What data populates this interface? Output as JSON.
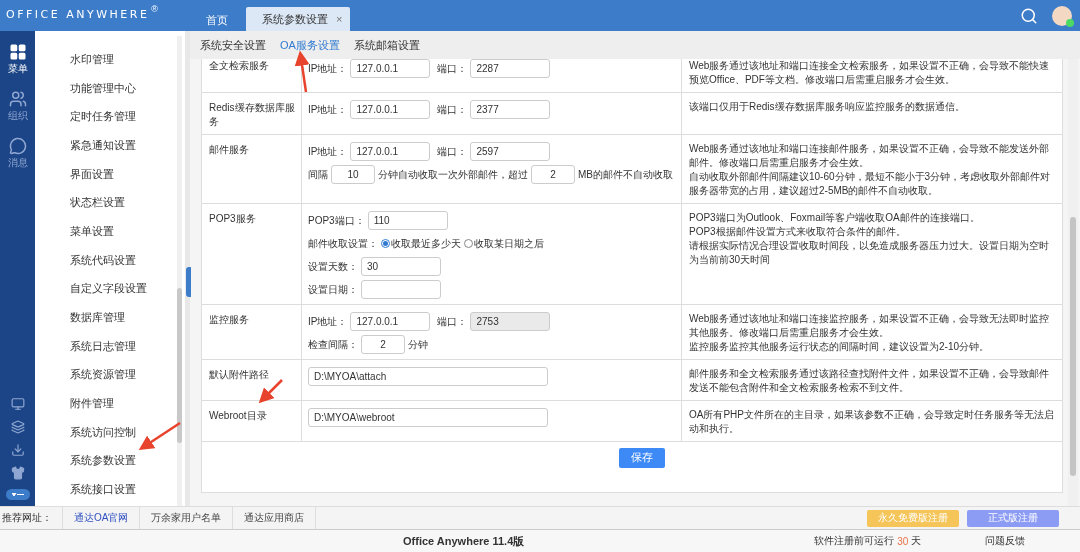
{
  "header": {
    "logo": "OFFICE ANYWHERE",
    "logo_mark": "®",
    "tabs": [
      {
        "label": "首页",
        "selected": false
      },
      {
        "label": "系统参数设置",
        "selected": true,
        "close": "×"
      }
    ]
  },
  "rail": {
    "items": [
      {
        "kind": "grid",
        "label": "菜单",
        "selected": true
      },
      {
        "kind": "users",
        "label": "组织",
        "selected": false
      },
      {
        "kind": "chat",
        "label": "消息",
        "selected": false
      }
    ],
    "tools": [
      {
        "kind": "monitor"
      },
      {
        "kind": "list"
      },
      {
        "kind": "download"
      },
      {
        "kind": "shirt"
      },
      {
        "kind": "toggle"
      }
    ]
  },
  "menu": {
    "items": [
      "水印管理",
      "功能管理中心",
      "定时任务管理",
      "紧急通知设置",
      "界面设置",
      "状态栏设置",
      "菜单设置",
      "系统代码设置",
      "自定义字段设置",
      "数据库管理",
      "系统日志管理",
      "系统资源管理",
      "附件管理",
      "系统访问控制",
      "系统参数设置",
      "系统接口设置"
    ]
  },
  "subtabs": [
    {
      "label": "系统安全设置",
      "selected": false
    },
    {
      "label": "OA服务设置",
      "selected": true
    },
    {
      "label": "系统邮箱设置",
      "selected": false
    }
  ],
  "rows": [
    {
      "label": "全文检索服务",
      "lines": [
        [
          {
            "kind": "label",
            "text": "IP地址："
          },
          {
            "kind": "field",
            "value": "127.0.0.1",
            "disabled": false
          },
          {
            "kind": "label",
            "text": "端口："
          },
          {
            "kind": "field",
            "value": "2287",
            "disabled": false
          }
        ]
      ],
      "notes": [
        "Web服务通过该地址和端口连接全文检索服务，如果设置不正确，会导致不能快速预览Office、PDF等文档。修改端口后需重启服务才会生效。"
      ]
    },
    {
      "label": "Redis缓存数据库服务",
      "lines": [
        [
          {
            "kind": "label",
            "text": "IP地址："
          },
          {
            "kind": "field",
            "value": "127.0.0.1",
            "disabled": false
          },
          {
            "kind": "label",
            "text": "端口："
          },
          {
            "kind": "field",
            "value": "2377",
            "disabled": false
          }
        ]
      ],
      "notes": [
        "该端口仅用于Redis缓存数据库服务响应监控服务的数据通信。"
      ]
    },
    {
      "label": "邮件服务",
      "lines": [
        [
          {
            "kind": "label",
            "text": "IP地址："
          },
          {
            "kind": "field",
            "value": "127.0.0.1",
            "disabled": false
          },
          {
            "kind": "label",
            "text": "端口："
          },
          {
            "kind": "field",
            "value": "2597",
            "disabled": false
          }
        ],
        [
          {
            "kind": "label",
            "text": "间隔"
          },
          {
            "kind": "number",
            "value": "10",
            "disabled": false
          },
          {
            "kind": "label",
            "text": "分钟自动收取一次外部邮件，超过"
          },
          {
            "kind": "number",
            "value": "2",
            "disabled": false
          },
          {
            "kind": "label",
            "text": "MB的邮件不自动收取"
          }
        ]
      ],
      "notes": [
        "Web服务通过该地址和端口连接邮件服务，如果设置不正确，会导致不能发送外部邮件。修改端口后需重启服务才会生效。",
        "自动收取外部邮件间隔建议10-60分钟，最短不能小于3分钟，考虑收取外部邮件对服务器带宽的占用，建议超过2-5MB的邮件不自动收取。"
      ]
    },
    {
      "label": "POP3服务",
      "lines": [
        [
          {
            "kind": "label",
            "text": "POP3端口："
          },
          {
            "kind": "field",
            "value": "110",
            "disabled": false
          }
        ],
        [
          {
            "kind": "label",
            "text": "邮件收取设置："
          },
          {
            "kind": "radio",
            "text": "收取最近多少天",
            "selected": true
          },
          {
            "kind": "radio",
            "text": "收取某日期之后",
            "selected": false
          }
        ],
        [
          {
            "kind": "label",
            "text": "设置天数："
          },
          {
            "kind": "field",
            "value": "30",
            "disabled": false
          }
        ],
        [
          {
            "kind": "label",
            "text": "设置日期："
          },
          {
            "kind": "field",
            "disabled": false
          }
        ]
      ],
      "notes": [
        "POP3端口为Outlook、Foxmail等客户端收取OA邮件的连接端口。",
        "POP3根据邮件设置方式来收取符合条件的邮件。",
        "请根据实际情况合理设置收取时间段，以免造成服务器压力过大。设置日期为空时为当前前30天时间"
      ]
    },
    {
      "label": "监控服务",
      "lines": [
        [
          {
            "kind": "label",
            "text": "IP地址："
          },
          {
            "kind": "field",
            "value": "127.0.0.1",
            "disabled": false
          },
          {
            "kind": "label",
            "text": "端口："
          },
          {
            "kind": "field",
            "value": "2753",
            "disabled": true
          }
        ],
        [
          {
            "kind": "label",
            "text": "检查间隔："
          },
          {
            "kind": "number",
            "value": "2",
            "disabled": false
          },
          {
            "kind": "label",
            "text": "分钟"
          }
        ]
      ],
      "notes": [
        "Web服务通过该地址和端口连接监控服务，如果设置不正确，会导致无法即时监控其他服务。修改端口后需重启服务才会生效。",
        "监控服务监控其他服务运行状态的间隔时间，建议设置为2-10分钟。"
      ]
    },
    {
      "label": "默认附件路径",
      "lines": [
        [
          {
            "kind": "path",
            "value": "D:\\MYOA\\attach",
            "disabled": false
          }
        ]
      ],
      "notes": [
        "邮件服务和全文检索服务通过该路径查找附件文件，如果设置不正确，会导致邮件发送不能包含附件和全文检索服务检索不到文件。"
      ]
    },
    {
      "label": "Webroot目录",
      "lines": [
        [
          {
            "kind": "path",
            "value": "D:\\MYOA\\webroot",
            "disabled": false
          }
        ]
      ],
      "notes": [
        "OA所有PHP文件所在的主目录，如果该参数不正确，会导致定时任务服务等无法启动和执行。"
      ]
    }
  ],
  "save": "保存",
  "links_bar": {
    "label": "推荐网址：",
    "links": [
      {
        "text": "通达OA官网",
        "selected": true
      },
      {
        "text": "万余家用户名单",
        "selected": false
      },
      {
        "text": "通达应用商店",
        "selected": false
      }
    ],
    "buttons": [
      {
        "text": "永久免费版注册",
        "color": "#f5c55a"
      },
      {
        "text": "正式版注册",
        "color": "#8c9cf5"
      }
    ]
  },
  "footer": {
    "title": "Office Anywhere 11.4版",
    "trial_before": "软件注册前可运行",
    "trial_days": "30",
    "trial_after": "天",
    "feedback": "问题反馈"
  },
  "annotations": [
    {
      "kind": "arrow"
    },
    {
      "kind": "arrow"
    },
    {
      "kind": "arrow"
    }
  ]
}
